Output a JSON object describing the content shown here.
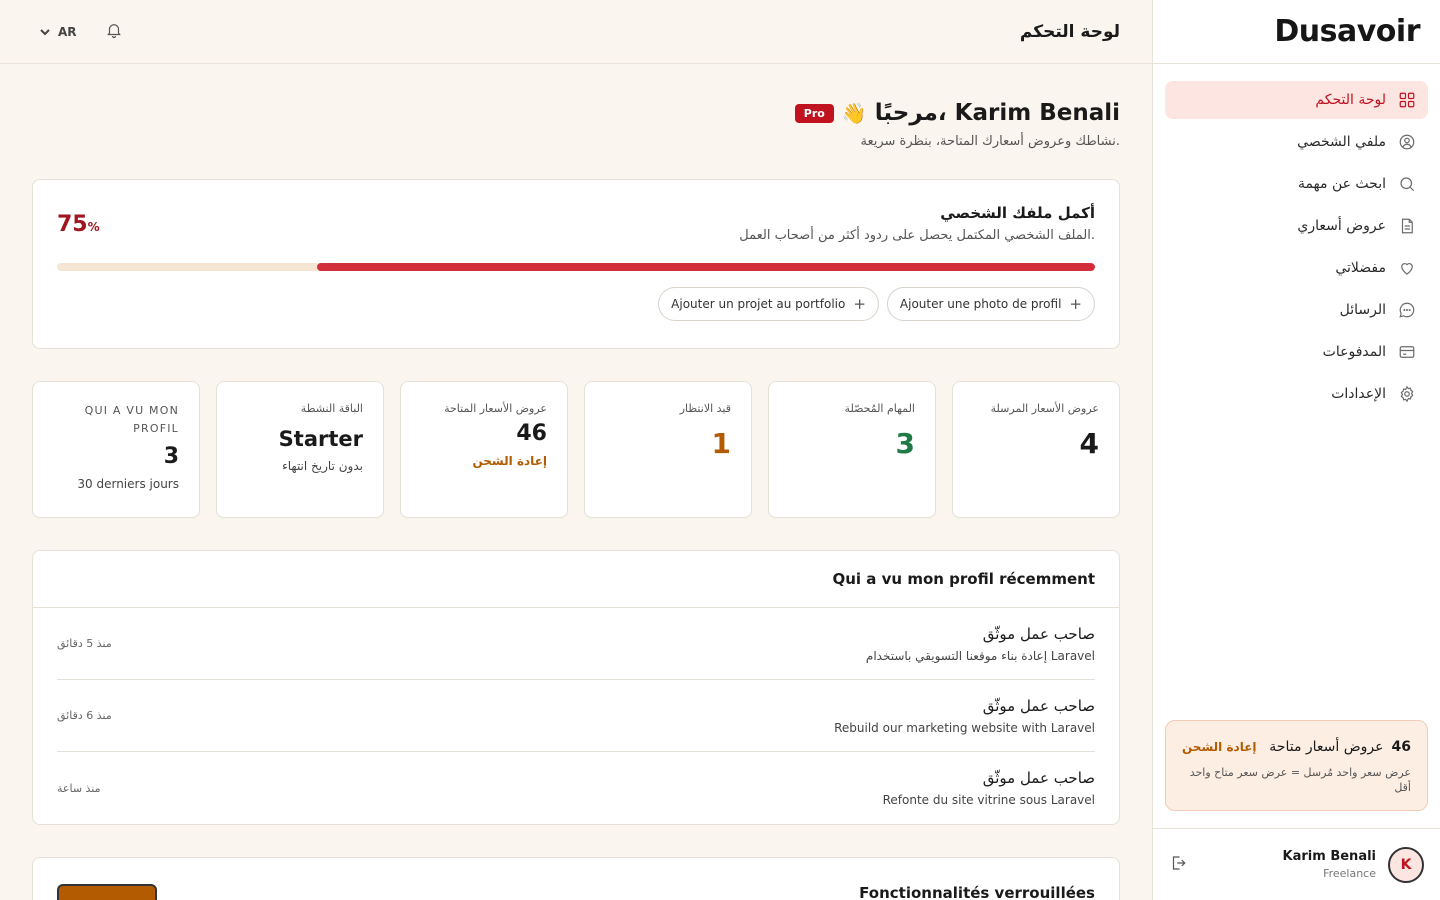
{
  "brand": {
    "logo_text": "Dusavoir"
  },
  "topbar": {
    "lang": "AR",
    "title": "لوحة التحكم"
  },
  "sidebar": {
    "items": [
      {
        "label": "لوحة التحكم",
        "icon": "grid-icon",
        "active": true
      },
      {
        "label": "ملفي الشخصي",
        "icon": "user-circle-icon"
      },
      {
        "label": "ابحث عن مهمة",
        "icon": "search-icon"
      },
      {
        "label": "عروض أسعاري",
        "icon": "document-icon"
      },
      {
        "label": "مفضلاتي",
        "icon": "heart-icon"
      },
      {
        "label": "الرسائل",
        "icon": "chat-icon"
      },
      {
        "label": "المدفوعات",
        "icon": "credit-card-icon"
      },
      {
        "label": "الإعدادات",
        "icon": "gear-icon"
      }
    ],
    "credits": {
      "count": "46",
      "label": "عروض أسعار متاحة",
      "reload": "إعادة الشحن",
      "note": "عرض سعر واحد مُرسل = عرض سعر متاح واحد أقل"
    },
    "user": {
      "initial": "K",
      "name": "Karim Benali",
      "role": "Freelance"
    }
  },
  "welcome": {
    "title": "مرحبًا، Karim Benali",
    "wave": "👋",
    "badge": "Pro",
    "subtitle": "نشاطك وعروض أسعارك المتاحة، بنظرة سريعة."
  },
  "profile_completion": {
    "title": "أكمل ملفك الشخصي",
    "subtitle": "الملف الشخصي المكتمل يحصل على ردود أكثر من أصحاب العمل.",
    "percent": "75",
    "percent_sign": "%",
    "progress_fraction": 0.75,
    "actions": [
      {
        "label": "Ajouter une photo de profil"
      },
      {
        "label": "Ajouter un projet au portfolio"
      }
    ]
  },
  "stats": {
    "sent": {
      "label": "عروض الأسعار المرسلة",
      "value": "4",
      "color": "#1a1a1a"
    },
    "completed": {
      "label": "المهام المُحصّلة",
      "value": "3",
      "color": "#1f7a45"
    },
    "pending": {
      "label": "قيد الانتظار",
      "value": "1",
      "color": "#b25b00"
    },
    "available": {
      "label": "عروض الأسعار المتاحة",
      "value": "46",
      "link": "إعادة الشحن"
    },
    "plan": {
      "label": "الباقة النشطة",
      "value": "Starter",
      "foot": "بدون تاريخ انتهاء"
    },
    "views": {
      "label": "QUI A VU MON PROFIL",
      "value": "3",
      "foot": "30 derniers jours"
    }
  },
  "recent_views": {
    "title": "Qui a vu mon profil récemment",
    "rows": [
      {
        "who": "صاحب عمل موثّق",
        "project": "إعادة بناء موقعنا التسويقي باستخدام Laravel",
        "time": "منذ 5 دقائق"
      },
      {
        "who": "صاحب عمل موثّق",
        "project": "Rebuild our marketing website with Laravel",
        "time": "منذ 6 دقائق"
      },
      {
        "who": "صاحب عمل موثّق",
        "project": "Refonte du site vitrine sous Laravel",
        "time": "منذ ساعة"
      }
    ]
  },
  "locked": {
    "title": "Fonctionnalités verrouillées"
  },
  "colors": {
    "accent": "#c1121f",
    "brand_orange": "#b25b00",
    "background": "#faf5ef"
  }
}
